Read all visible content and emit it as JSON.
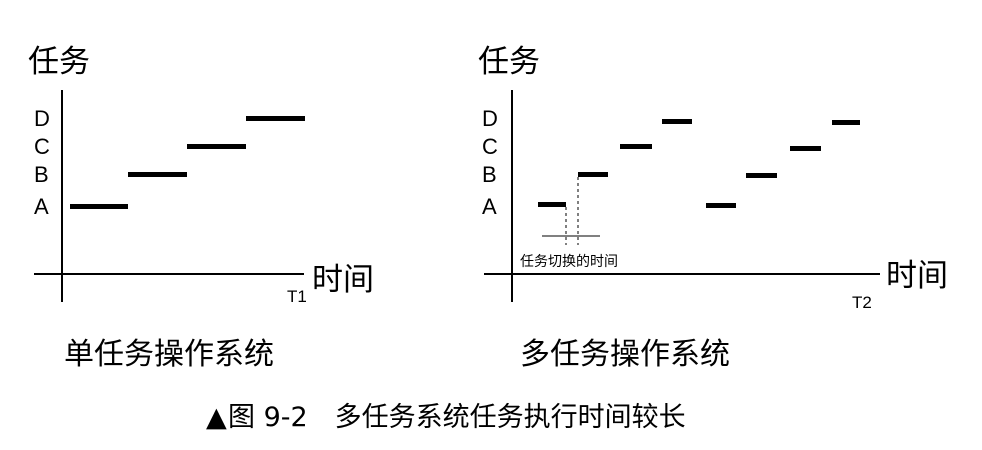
{
  "left_panel": {
    "y_axis_label": "任务",
    "x_axis_label": "时间",
    "end_marker": "T1",
    "subtitle": "单任务操作系统",
    "task_labels": [
      "D",
      "C",
      "B",
      "A"
    ]
  },
  "right_panel": {
    "y_axis_label": "任务",
    "x_axis_label": "时间",
    "end_marker": "T2",
    "subtitle": "多任务操作系统",
    "task_labels": [
      "D",
      "C",
      "B",
      "A"
    ],
    "switch_annotation": "任务切换的时间"
  },
  "caption": {
    "marker": "▲",
    "text": "图 9-2　多任务系统任务执行时间较长"
  }
}
